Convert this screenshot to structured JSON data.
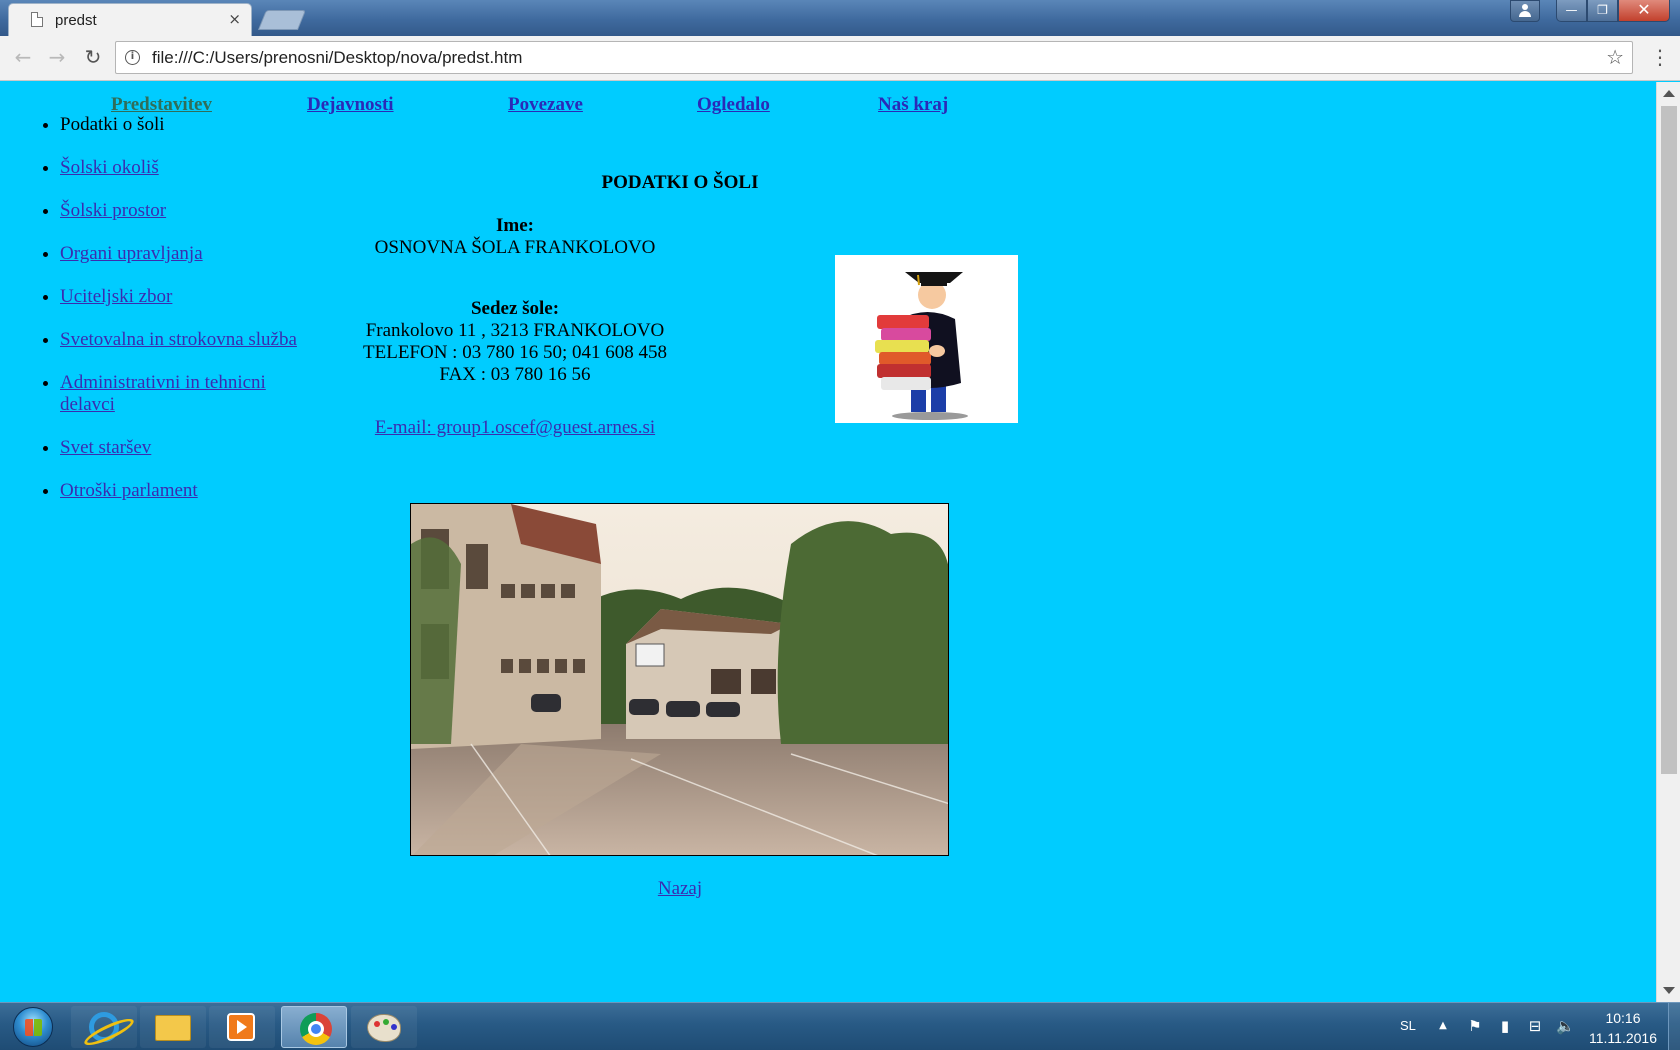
{
  "browser": {
    "tab_title": "predst",
    "tab_close": "×",
    "url": "file:///C:/Users/prenosni/Desktop/nova/predst.htm",
    "nav": {
      "back": "←",
      "forward": "→",
      "reload": "↻",
      "info": "i",
      "star": "☆",
      "menu": "⋮"
    },
    "window": {
      "minimize": "—",
      "maximize": "❐",
      "close": "✕"
    }
  },
  "top_nav": [
    {
      "label": "Predstavitev",
      "current": true
    },
    {
      "label": "Dejavnosti",
      "current": false
    },
    {
      "label": "Povezave",
      "current": false
    },
    {
      "label": "Ogledalo",
      "current": false
    },
    {
      "label": "Naš kraj",
      "current": false
    }
  ],
  "side_nav": [
    {
      "label": "Podatki o šoli",
      "active": true
    },
    {
      "label": "Šolski okoliš",
      "active": false
    },
    {
      "label": "Šolski prostor",
      "active": false
    },
    {
      "label": "Organi upravljanja",
      "active": false
    },
    {
      "label": "Uciteljski zbor",
      "active": false
    },
    {
      "label": "Svetovalna in strokovna služba",
      "active": false
    },
    {
      "label": "Administrativni in tehnicni delavci",
      "active": false
    },
    {
      "label": "Svet staršev",
      "active": false
    },
    {
      "label": "Otroški parlament",
      "active": false
    }
  ],
  "main": {
    "heading": "PODATKI O ŠOLI",
    "name_label": "Ime:",
    "name_value": "OSNOVNA ŠOLA FRANKOLOVO",
    "seat_label": "Sedez šole:",
    "address": "Frankolovo 11 , 3213 FRANKOLOVO",
    "phone": "TELEFON : 03 780 16 50; 041 608 458",
    "fax": "FAX : 03 780 16 56",
    "email": "E-mail: group1.oscef@guest.arnes.si",
    "back_link": "Nazaj"
  },
  "taskbar": {
    "language": "SL",
    "time": "10:16",
    "date": "11.11.2016",
    "tray": {
      "show_hidden": "▲",
      "flag": "⚑",
      "power": "▮",
      "network": "⊟",
      "volume": "🔈"
    }
  },
  "colors": {
    "page_background": "#00CCFF",
    "link": "#3a2cb0",
    "visited_current": "#2f6e5a"
  }
}
